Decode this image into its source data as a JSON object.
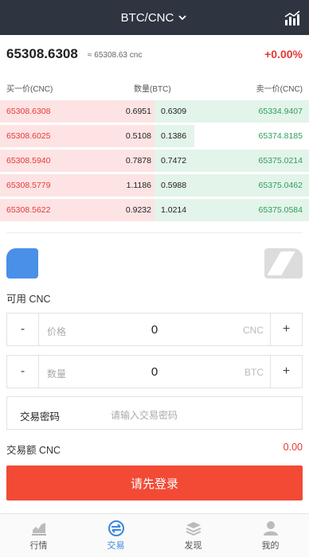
{
  "header": {
    "title": "BTC/CNC"
  },
  "ticker": {
    "price": "65308.6308",
    "approx": "≈ 65308.63 cnc",
    "change": "+0.00%"
  },
  "orderbook": {
    "headers": {
      "buy": "买一价(CNC)",
      "qty": "数量(BTC)",
      "sell": "卖一价(CNC)"
    },
    "rows": [
      {
        "buy_price": "65308.6308",
        "buy_qty": "0.6951",
        "sell_qty": "0.6309",
        "sell_price": "65334.9407",
        "buy_depth": 1.0,
        "sell_depth": 1.0
      },
      {
        "buy_price": "65308.6025",
        "buy_qty": "0.5108",
        "sell_qty": "0.1386",
        "sell_price": "65374.8185",
        "buy_depth": 1.0,
        "sell_depth": 0.26
      },
      {
        "buy_price": "65308.5940",
        "buy_qty": "0.7878",
        "sell_qty": "0.7472",
        "sell_price": "65375.0214",
        "buy_depth": 1.0,
        "sell_depth": 1.0
      },
      {
        "buy_price": "65308.5779",
        "buy_qty": "1.1186",
        "sell_qty": "0.5988",
        "sell_price": "65375.0462",
        "buy_depth": 1.0,
        "sell_depth": 1.0
      },
      {
        "buy_price": "65308.5622",
        "buy_qty": "0.9232",
        "sell_qty": "1.0214",
        "sell_price": "65375.0584",
        "buy_depth": 1.0,
        "sell_depth": 1.0
      }
    ]
  },
  "form": {
    "available": "可用 CNC",
    "price": {
      "minus": "-",
      "placeholder": "价格",
      "value": "0",
      "unit": "CNC",
      "plus": "+"
    },
    "quantity": {
      "minus": "-",
      "placeholder": "数量",
      "value": "0",
      "unit": "BTC",
      "plus": "+"
    },
    "password": {
      "label": "交易密码",
      "placeholder": "请输入交易密码"
    },
    "amount": {
      "label": "交易额 CNC",
      "value": "0.00"
    },
    "submit": "请先登录"
  },
  "nav": [
    {
      "label": "行情",
      "icon": "market-chart-icon",
      "active": false
    },
    {
      "label": "交易",
      "icon": "trade-icon",
      "active": true
    },
    {
      "label": "发现",
      "icon": "layers-icon",
      "active": false
    },
    {
      "label": "我的",
      "icon": "user-icon",
      "active": false
    }
  ],
  "colors": {
    "accent": "#3a86e0",
    "buy": "#e53935",
    "sell": "#2e9e5a",
    "header_bg": "#2e3440",
    "button": "#f24a35"
  }
}
